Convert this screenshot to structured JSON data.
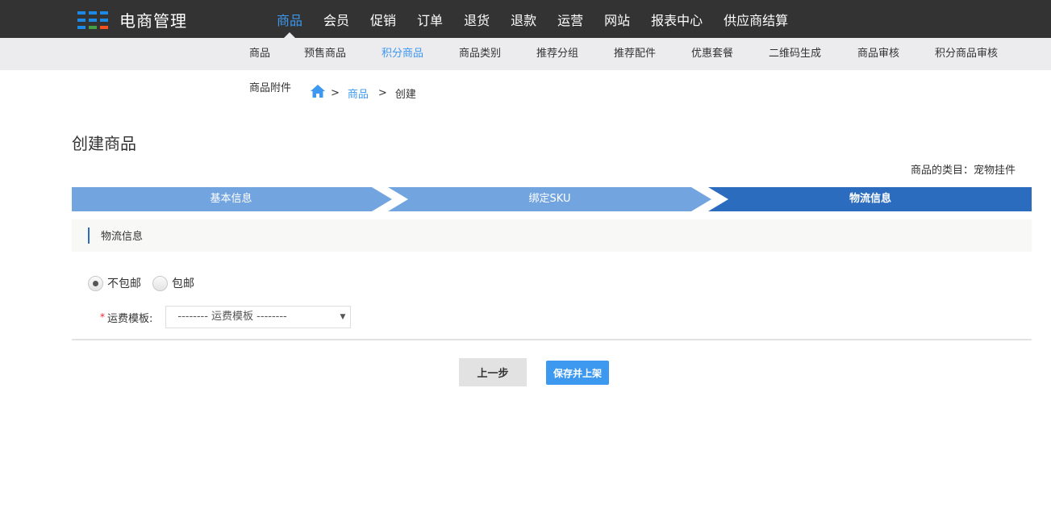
{
  "colors": {
    "topbar": "#333333",
    "accent": "#3d98f0",
    "step_light": "#72a5df",
    "step_active": "#2c6cbf",
    "logo_blue": "#1e88e5",
    "logo_green": "#43a047",
    "logo_orange": "#f4511e"
  },
  "logo": {
    "icon": "grid-logo-icon",
    "text": "电商管理"
  },
  "main_nav": [
    {
      "label": "商品",
      "active": true
    },
    {
      "label": "会员",
      "active": false
    },
    {
      "label": "促销",
      "active": false
    },
    {
      "label": "订单",
      "active": false
    },
    {
      "label": "退货",
      "active": false
    },
    {
      "label": "退款",
      "active": false
    },
    {
      "label": "运营",
      "active": false
    },
    {
      "label": "网站",
      "active": false
    },
    {
      "label": "报表中心",
      "active": false
    },
    {
      "label": "供应商结算",
      "active": false
    }
  ],
  "sub_nav": [
    {
      "label": "商品",
      "active": false
    },
    {
      "label": "预售商品",
      "active": false
    },
    {
      "label": "积分商品",
      "active": true
    },
    {
      "label": "商品类别",
      "active": false
    },
    {
      "label": "推荐分组",
      "active": false
    },
    {
      "label": "推荐配件",
      "active": false
    },
    {
      "label": "优惠套餐",
      "active": false
    },
    {
      "label": "二维码生成",
      "active": false
    },
    {
      "label": "商品审核",
      "active": false
    },
    {
      "label": "积分商品审核",
      "active": false
    },
    {
      "label": "商品附件",
      "active": false
    }
  ],
  "breadcrumb": {
    "home_icon": "home-icon",
    "sep": ">",
    "link": "商品",
    "current": "创建"
  },
  "page_title": "创建商品",
  "category": {
    "label": "商品的类目：",
    "value": "宠物挂件"
  },
  "steps": [
    {
      "label": "基本信息",
      "active": false
    },
    {
      "label": "绑定SKU",
      "active": false
    },
    {
      "label": "物流信息",
      "active": true
    }
  ],
  "section_title": "物流信息",
  "shipping_options": [
    {
      "label": "不包邮",
      "checked": true
    },
    {
      "label": "包邮",
      "checked": false
    }
  ],
  "template": {
    "required_mark": "*",
    "label": "运费模板:",
    "selected": "-------- 运费模板 --------",
    "caret_icon": "caret-down-icon"
  },
  "buttons": {
    "prev": "上一步",
    "save": "保存并上架"
  }
}
